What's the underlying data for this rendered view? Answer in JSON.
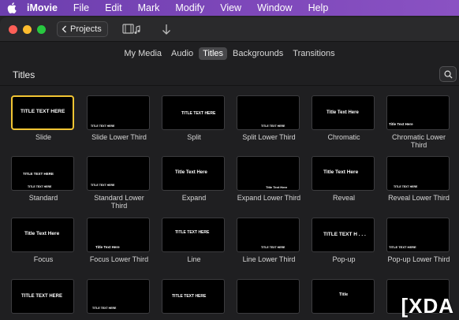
{
  "menubar": {
    "app": "iMovie",
    "items": [
      "File",
      "Edit",
      "Mark",
      "Modify",
      "View",
      "Window",
      "Help"
    ]
  },
  "toolbar": {
    "projects_label": "Projects"
  },
  "tabs": [
    {
      "label": "My Media",
      "active": false
    },
    {
      "label": "Audio",
      "active": false
    },
    {
      "label": "Titles",
      "active": true
    },
    {
      "label": "Backgrounds",
      "active": false
    },
    {
      "label": "Transitions",
      "active": false
    }
  ],
  "section": {
    "title": "Titles"
  },
  "titles": [
    {
      "label": "Slide",
      "thumb_text": "TITLE TEXT HERE",
      "selected": true
    },
    {
      "label": "Slide Lower Third",
      "thumb_text": "TITLE TEXT HERE",
      "selected": false
    },
    {
      "label": "Split",
      "thumb_text": "TITLE TEXT HERE",
      "selected": false
    },
    {
      "label": "Split Lower Third",
      "thumb_text": "TITLE TEXT HERE",
      "selected": false
    },
    {
      "label": "Chromatic",
      "thumb_text": "Title Text Here",
      "selected": false
    },
    {
      "label": "Chromatic Lower Third",
      "thumb_text": "Title Text Here",
      "selected": false
    },
    {
      "label": "Standard",
      "thumb_text": "TITLE TEXT HERE",
      "thumb_sub": "TITLE TEXT HERE",
      "selected": false
    },
    {
      "label": "Standard Lower Third",
      "thumb_text": "TITLE TEXT HERE",
      "selected": false
    },
    {
      "label": "Expand",
      "thumb_text": "Title Text Here",
      "selected": false
    },
    {
      "label": "Expand Lower Third",
      "thumb_text": "Title Text Here",
      "selected": false
    },
    {
      "label": "Reveal",
      "thumb_text": "Title Text Here",
      "selected": false
    },
    {
      "label": "Reveal Lower Third",
      "thumb_text": "TITLE TEXT HERE",
      "selected": false
    },
    {
      "label": "Focus",
      "thumb_text": "Title Text Here",
      "selected": false
    },
    {
      "label": "Focus Lower Third",
      "thumb_text": "Title Text Here",
      "selected": false
    },
    {
      "label": "Line",
      "thumb_text": "TITLE TEXT HERE",
      "selected": false
    },
    {
      "label": "Line Lower Third",
      "thumb_text": "TITLE TEXT HERE",
      "selected": false
    },
    {
      "label": "Pop-up",
      "thumb_text": "TITLE TEXT H . . .",
      "selected": false
    },
    {
      "label": "Pop-up Lower Third",
      "thumb_text": "TITLE TEXT HERE",
      "selected": false
    },
    {
      "label": "",
      "thumb_text": "TITLE TEXT HERE",
      "selected": false
    },
    {
      "label": "",
      "thumb_text": "TITLE TEXT HERE",
      "selected": false
    },
    {
      "label": "",
      "thumb_text": "TITLE TEXT HERE",
      "selected": false
    },
    {
      "label": "",
      "thumb_text": "",
      "selected": false
    },
    {
      "label": "",
      "thumb_text": "Title",
      "selected": false
    },
    {
      "label": "",
      "thumb_text": "",
      "selected": false
    }
  ],
  "watermark": "[XDA",
  "colors": {
    "selection": "#f2c533",
    "menubar": "#7b46b8",
    "background": "#1f1f21"
  }
}
